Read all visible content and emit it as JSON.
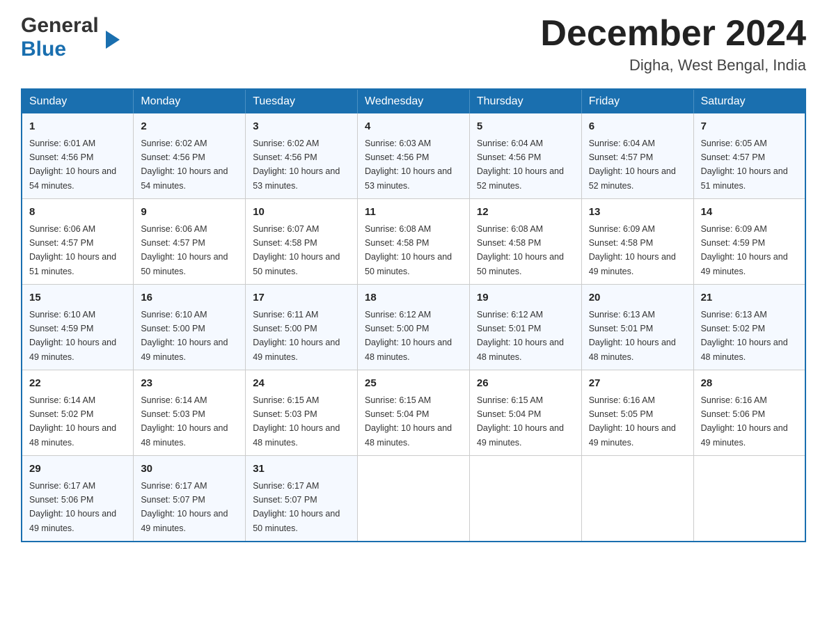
{
  "header": {
    "logo": {
      "general": "General",
      "arrow": "▶",
      "blue": "Blue"
    },
    "title": "December 2024",
    "location": "Digha, West Bengal, India"
  },
  "calendar": {
    "days_of_week": [
      "Sunday",
      "Monday",
      "Tuesday",
      "Wednesday",
      "Thursday",
      "Friday",
      "Saturday"
    ],
    "weeks": [
      [
        {
          "day": 1,
          "sunrise": "6:01 AM",
          "sunset": "4:56 PM",
          "daylight": "10 hours and 54 minutes."
        },
        {
          "day": 2,
          "sunrise": "6:02 AM",
          "sunset": "4:56 PM",
          "daylight": "10 hours and 54 minutes."
        },
        {
          "day": 3,
          "sunrise": "6:02 AM",
          "sunset": "4:56 PM",
          "daylight": "10 hours and 53 minutes."
        },
        {
          "day": 4,
          "sunrise": "6:03 AM",
          "sunset": "4:56 PM",
          "daylight": "10 hours and 53 minutes."
        },
        {
          "day": 5,
          "sunrise": "6:04 AM",
          "sunset": "4:56 PM",
          "daylight": "10 hours and 52 minutes."
        },
        {
          "day": 6,
          "sunrise": "6:04 AM",
          "sunset": "4:57 PM",
          "daylight": "10 hours and 52 minutes."
        },
        {
          "day": 7,
          "sunrise": "6:05 AM",
          "sunset": "4:57 PM",
          "daylight": "10 hours and 51 minutes."
        }
      ],
      [
        {
          "day": 8,
          "sunrise": "6:06 AM",
          "sunset": "4:57 PM",
          "daylight": "10 hours and 51 minutes."
        },
        {
          "day": 9,
          "sunrise": "6:06 AM",
          "sunset": "4:57 PM",
          "daylight": "10 hours and 50 minutes."
        },
        {
          "day": 10,
          "sunrise": "6:07 AM",
          "sunset": "4:58 PM",
          "daylight": "10 hours and 50 minutes."
        },
        {
          "day": 11,
          "sunrise": "6:08 AM",
          "sunset": "4:58 PM",
          "daylight": "10 hours and 50 minutes."
        },
        {
          "day": 12,
          "sunrise": "6:08 AM",
          "sunset": "4:58 PM",
          "daylight": "10 hours and 50 minutes."
        },
        {
          "day": 13,
          "sunrise": "6:09 AM",
          "sunset": "4:58 PM",
          "daylight": "10 hours and 49 minutes."
        },
        {
          "day": 14,
          "sunrise": "6:09 AM",
          "sunset": "4:59 PM",
          "daylight": "10 hours and 49 minutes."
        }
      ],
      [
        {
          "day": 15,
          "sunrise": "6:10 AM",
          "sunset": "4:59 PM",
          "daylight": "10 hours and 49 minutes."
        },
        {
          "day": 16,
          "sunrise": "6:10 AM",
          "sunset": "5:00 PM",
          "daylight": "10 hours and 49 minutes."
        },
        {
          "day": 17,
          "sunrise": "6:11 AM",
          "sunset": "5:00 PM",
          "daylight": "10 hours and 49 minutes."
        },
        {
          "day": 18,
          "sunrise": "6:12 AM",
          "sunset": "5:00 PM",
          "daylight": "10 hours and 48 minutes."
        },
        {
          "day": 19,
          "sunrise": "6:12 AM",
          "sunset": "5:01 PM",
          "daylight": "10 hours and 48 minutes."
        },
        {
          "day": 20,
          "sunrise": "6:13 AM",
          "sunset": "5:01 PM",
          "daylight": "10 hours and 48 minutes."
        },
        {
          "day": 21,
          "sunrise": "6:13 AM",
          "sunset": "5:02 PM",
          "daylight": "10 hours and 48 minutes."
        }
      ],
      [
        {
          "day": 22,
          "sunrise": "6:14 AM",
          "sunset": "5:02 PM",
          "daylight": "10 hours and 48 minutes."
        },
        {
          "day": 23,
          "sunrise": "6:14 AM",
          "sunset": "5:03 PM",
          "daylight": "10 hours and 48 minutes."
        },
        {
          "day": 24,
          "sunrise": "6:15 AM",
          "sunset": "5:03 PM",
          "daylight": "10 hours and 48 minutes."
        },
        {
          "day": 25,
          "sunrise": "6:15 AM",
          "sunset": "5:04 PM",
          "daylight": "10 hours and 48 minutes."
        },
        {
          "day": 26,
          "sunrise": "6:15 AM",
          "sunset": "5:04 PM",
          "daylight": "10 hours and 49 minutes."
        },
        {
          "day": 27,
          "sunrise": "6:16 AM",
          "sunset": "5:05 PM",
          "daylight": "10 hours and 49 minutes."
        },
        {
          "day": 28,
          "sunrise": "6:16 AM",
          "sunset": "5:06 PM",
          "daylight": "10 hours and 49 minutes."
        }
      ],
      [
        {
          "day": 29,
          "sunrise": "6:17 AM",
          "sunset": "5:06 PM",
          "daylight": "10 hours and 49 minutes."
        },
        {
          "day": 30,
          "sunrise": "6:17 AM",
          "sunset": "5:07 PM",
          "daylight": "10 hours and 49 minutes."
        },
        {
          "day": 31,
          "sunrise": "6:17 AM",
          "sunset": "5:07 PM",
          "daylight": "10 hours and 50 minutes."
        },
        null,
        null,
        null,
        null
      ]
    ]
  }
}
